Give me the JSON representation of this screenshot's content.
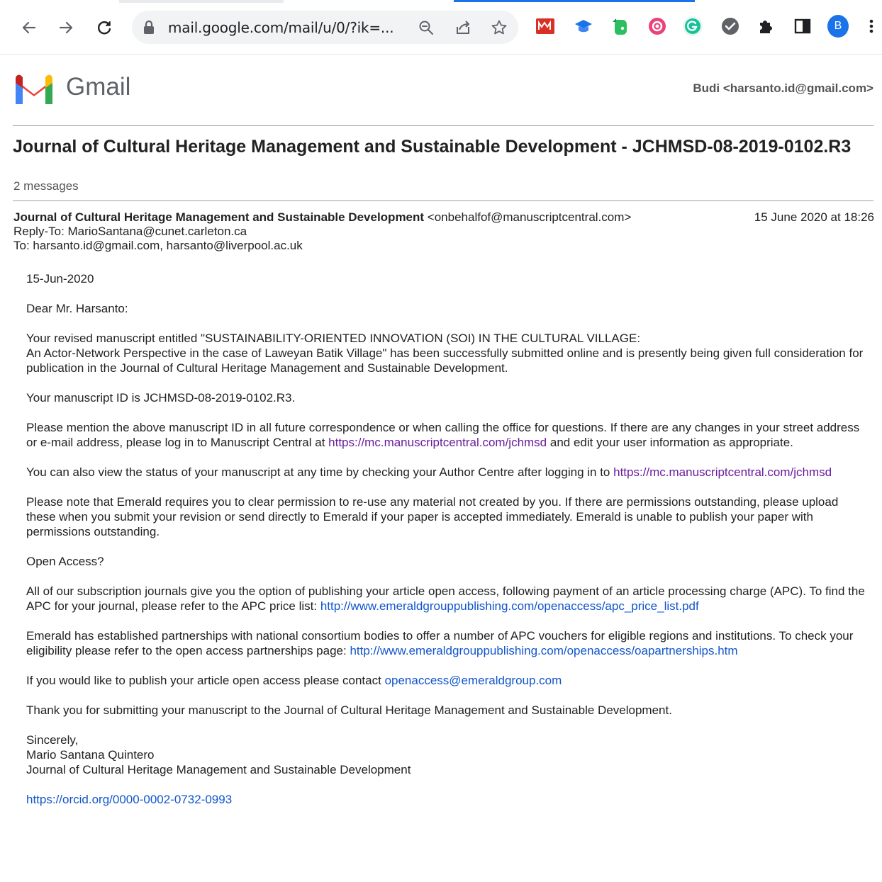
{
  "browser": {
    "url": "mail.google.com/mail/u/0/?ik=...",
    "profile_initial": "B",
    "icons": [
      "back-icon",
      "forward-icon",
      "reload-icon",
      "lock-icon",
      "zoom-icon",
      "share-icon",
      "star-icon"
    ],
    "extensions": [
      "m-extension-icon",
      "cap-extension-icon",
      "evernote-icon",
      "record-icon",
      "grammarly-icon",
      "check-icon",
      "puzzle-icon",
      "sidepanel-icon"
    ]
  },
  "gmail": {
    "brand": "Gmail",
    "account": "Budi <harsanto.id@gmail.com>",
    "subject": "Journal of Cultural Heritage Management and Sustainable Development - JCHMSD-08-2019-0102.R3",
    "message_count": "2 messages"
  },
  "message": {
    "from_name": "Journal of Cultural Heritage Management and Sustainable Development",
    "from_addr": "<onbehalfof@manuscriptcentral.com>",
    "date": "15 June 2020 at 18:26",
    "reply_to": "Reply-To: MarioSantana@cunet.carleton.ca",
    "to": "To: harsanto.id@gmail.com, harsanto@liverpool.ac.uk",
    "body": {
      "date_line": "15-Jun-2020",
      "salutation": "Dear Mr. Harsanto:",
      "p1_line1": "Your revised manuscript entitled \"SUSTAINABILITY-ORIENTED INNOVATION (SOI) IN THE CULTURAL VILLAGE:",
      "p1_rest": "An Actor-Network Perspective in the case of Laweyan Batik Village\" has been successfully submitted online and is presently being given full consideration for publication in the Journal of Cultural Heritage Management and Sustainable Development.",
      "p2": "Your manuscript ID is JCHMSD-08-2019-0102.R3.",
      "p3_before": "Please mention the above manuscript ID in all future correspondence or when calling the office for questions. If there are any changes in your street address or e-mail address, please log in to Manuscript Central at ",
      "p3_link": "https://mc.manuscriptcentral.com/jchmsd",
      "p3_after": " and edit your user information as appropriate.",
      "p4_before": "You can also view the status of your manuscript at any time by checking your Author Centre after logging in to ",
      "p4_link": "https://mc.manuscriptcentral.com/jchmsd",
      "p5": "Please note that Emerald requires you to clear permission to re-use any material not created by you.  If there are permissions outstanding, please upload these when you submit your revision or send directly to Emerald if your paper is accepted immediately.  Emerald is unable to publish your paper with permissions outstanding.",
      "p6": "Open Access?",
      "p7_before": "All of our subscription journals give you the option of publishing your article open access, following payment of an article processing charge (APC). To find the APC for your journal, please refer to the  APC price list: ",
      "p7_link": "http://www.emeraldgrouppublishing.com/openaccess/apc_price_list.pdf",
      "p8_before": "Emerald has established partnerships with national consortium bodies to offer a number of APC vouchers for eligible regions and institutions. To check your eligibility please refer to the open access partnerships page: ",
      "p8_link": "http://www.emeraldgrouppublishing.com/openaccess/oapartnerships.htm",
      "p9_before": "If you would like to publish your article open access please contact  ",
      "p9_link": "openaccess@emeraldgroup.com",
      "p10": "Thank you for submitting your manuscript to the Journal of Cultural Heritage Management and Sustainable Development.",
      "sig_closing": "Sincerely,",
      "sig_name": "Mario Santana Quintero",
      "sig_org": "Journal of Cultural Heritage Management and Sustainable Development",
      "orcid_link": "https://orcid.org/0000-0002-0732-0993"
    }
  }
}
